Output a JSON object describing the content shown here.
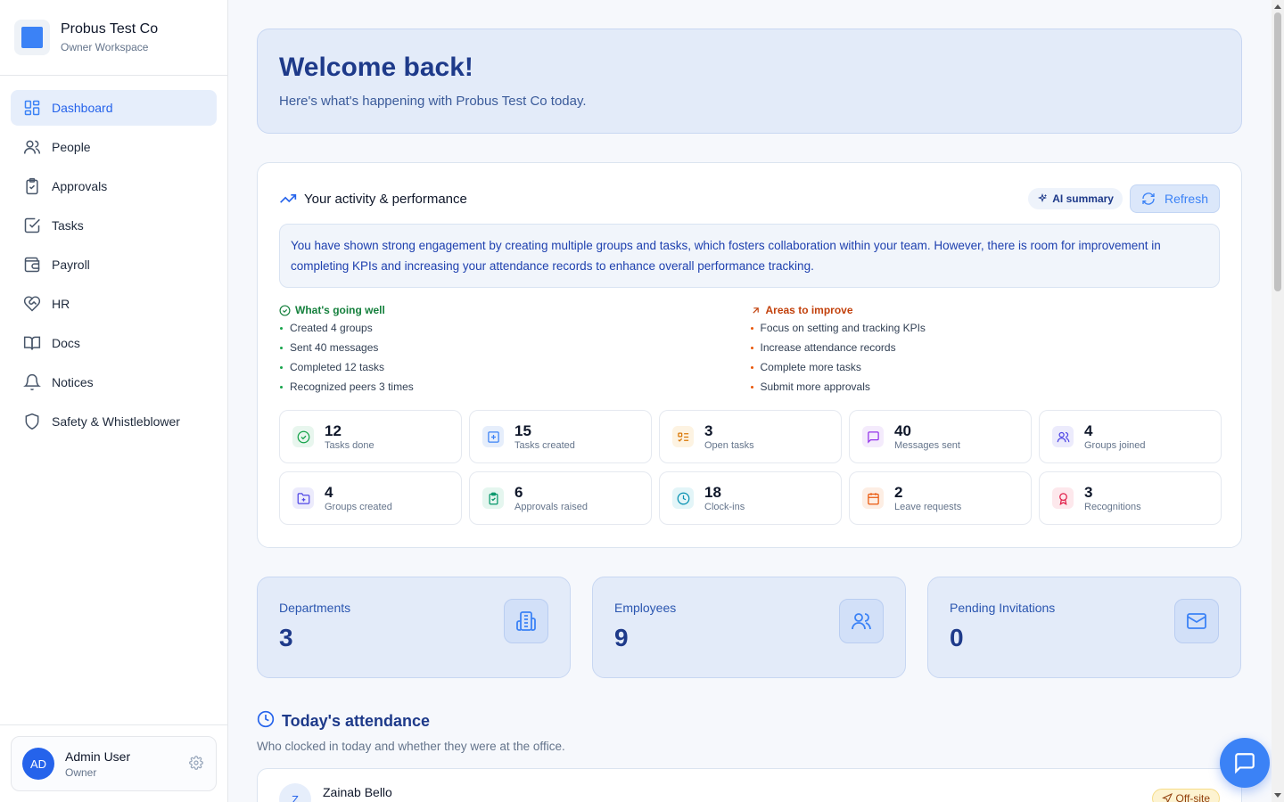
{
  "brand": {
    "name": "Probus Test Co",
    "subtitle": "Owner Workspace"
  },
  "sidebar": {
    "items": [
      {
        "label": "Dashboard",
        "icon": "grid-icon",
        "active": true
      },
      {
        "label": "People",
        "icon": "users-icon"
      },
      {
        "label": "Approvals",
        "icon": "clipboard-check-icon"
      },
      {
        "label": "Tasks",
        "icon": "check-square-icon"
      },
      {
        "label": "Payroll",
        "icon": "wallet-icon"
      },
      {
        "label": "HR",
        "icon": "heart-handshake-icon"
      },
      {
        "label": "Docs",
        "icon": "book-icon"
      },
      {
        "label": "Notices",
        "icon": "bell-icon"
      },
      {
        "label": "Safety & Whistleblower",
        "icon": "shield-icon"
      }
    ]
  },
  "user": {
    "initials": "AD",
    "name": "Admin User",
    "role": "Owner"
  },
  "welcome": {
    "title": "Welcome back!",
    "subtitle": "Here's what's happening with Probus Test Co today."
  },
  "performance": {
    "title": "Your activity & performance",
    "ai_badge": "AI summary",
    "refresh_label": "Refresh",
    "summary": "You have shown strong engagement by creating multiple groups and tasks, which fosters collaboration within your team. However, there is room for improvement in completing KPIs and increasing your attendance records to enhance overall performance tracking.",
    "going_well": {
      "title": "What's going well",
      "items": [
        "Created 4 groups",
        "Sent 40 messages",
        "Completed 12 tasks",
        "Recognized peers 3 times"
      ]
    },
    "improve": {
      "title": "Areas to improve",
      "items": [
        "Focus on setting and tracking KPIs",
        "Increase attendance records",
        "Complete more tasks",
        "Submit more approvals"
      ]
    },
    "stats": [
      {
        "value": "12",
        "label": "Tasks done",
        "icon": "check-circle-icon",
        "color": "#16a34a",
        "bg": "#e8f6ee"
      },
      {
        "value": "15",
        "label": "Tasks created",
        "icon": "plus-square-icon",
        "color": "#3b82f6",
        "bg": "#e6eefb"
      },
      {
        "value": "3",
        "label": "Open tasks",
        "icon": "list-todo-icon",
        "color": "#d97706",
        "bg": "#fdf3e2"
      },
      {
        "value": "40",
        "label": "Messages sent",
        "icon": "message-square-icon",
        "color": "#9333ea",
        "bg": "#f4ebfc"
      },
      {
        "value": "4",
        "label": "Groups joined",
        "icon": "users-icon",
        "color": "#4f46e5",
        "bg": "#ecebfc"
      },
      {
        "value": "4",
        "label": "Groups created",
        "icon": "folder-plus-icon",
        "color": "#4f46e5",
        "bg": "#ecebfc"
      },
      {
        "value": "6",
        "label": "Approvals raised",
        "icon": "clipboard-check-icon",
        "color": "#059669",
        "bg": "#e5f6ef"
      },
      {
        "value": "18",
        "label": "Clock-ins",
        "icon": "clock-icon",
        "color": "#0891b2",
        "bg": "#e3f5f8"
      },
      {
        "value": "2",
        "label": "Leave requests",
        "icon": "calendar-icon",
        "color": "#ea580c",
        "bg": "#fdeee4"
      },
      {
        "value": "3",
        "label": "Recognitions",
        "icon": "award-icon",
        "color": "#e11d48",
        "bg": "#fde8ec"
      }
    ]
  },
  "metrics": [
    {
      "label": "Departments",
      "value": "3",
      "icon": "building-icon"
    },
    {
      "label": "Employees",
      "value": "9",
      "icon": "users-icon"
    },
    {
      "label": "Pending Invitations",
      "value": "0",
      "icon": "mail-icon"
    }
  ],
  "attendance": {
    "title": "Today's attendance",
    "subtitle": "Who clocked in today and whether they were at the office.",
    "rows": [
      {
        "initial": "Z",
        "name": "Zainab Bello",
        "status": "Off-site"
      }
    ]
  }
}
